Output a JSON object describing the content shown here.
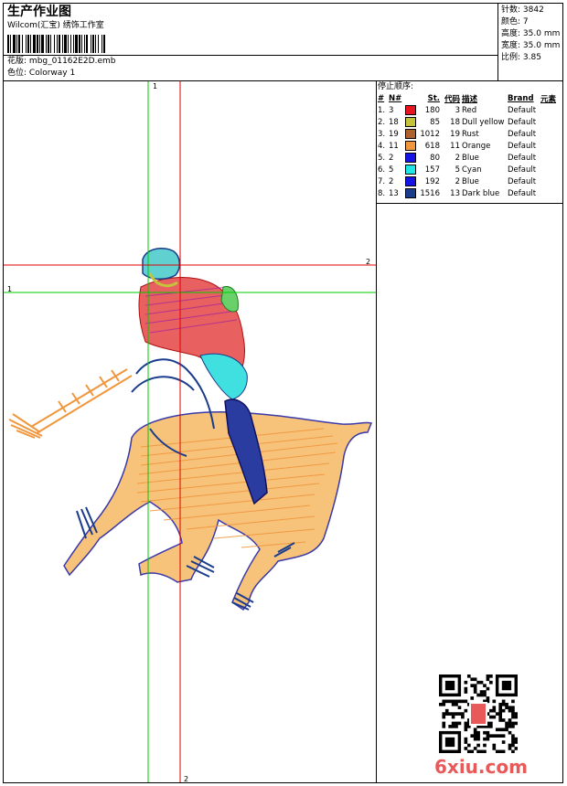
{
  "header": {
    "title": "生产作业图",
    "studio": "Wilcom(汇宝) 绣饰工作室",
    "design_file_label": "花版:",
    "design_file": "mbg_01162E2D.emb",
    "colorway_label": "色位:",
    "colorway": "Colorway 1"
  },
  "stats": [
    {
      "label": "针数:",
      "value": "3842"
    },
    {
      "label": "颜色:",
      "value": "7"
    },
    {
      "label": "高度:",
      "value": "35.0 mm"
    },
    {
      "label": "宽度:",
      "value": "35.0 mm"
    },
    {
      "label": "比例:",
      "value": "3.85"
    }
  ],
  "stop_sequence": {
    "title": "停止顺序:",
    "columns": [
      "#",
      "N#",
      "St.",
      "代码",
      "描述",
      "Brand",
      "元素"
    ],
    "rows": [
      {
        "idx": "1.",
        "needle": "3",
        "color": "#e8141e",
        "stitches": "180",
        "code": "3",
        "desc": "Red",
        "brand": "Default"
      },
      {
        "idx": "2.",
        "needle": "18",
        "color": "#c4c43a",
        "stitches": "85",
        "code": "18",
        "desc": "Dull yellow",
        "brand": "Default"
      },
      {
        "idx": "3.",
        "needle": "19",
        "color": "#b0602c",
        "stitches": "1012",
        "code": "19",
        "desc": "Rust",
        "brand": "Default"
      },
      {
        "idx": "4.",
        "needle": "11",
        "color": "#f0963c",
        "stitches": "618",
        "code": "11",
        "desc": "Orange",
        "brand": "Default"
      },
      {
        "idx": "5.",
        "needle": "2",
        "color": "#1414e6",
        "stitches": "80",
        "code": "2",
        "desc": "Blue",
        "brand": "Default"
      },
      {
        "idx": "6.",
        "needle": "5",
        "color": "#1ee6e6",
        "stitches": "157",
        "code": "5",
        "desc": "Cyan",
        "brand": "Default"
      },
      {
        "idx": "7.",
        "needle": "2",
        "color": "#1414e6",
        "stitches": "192",
        "code": "2",
        "desc": "Blue",
        "brand": "Default"
      },
      {
        "idx": "8.",
        "needle": "13",
        "color": "#1a3c8c",
        "stitches": "1516",
        "code": "13",
        "desc": "Dark blue",
        "brand": "Default"
      }
    ]
  },
  "guides": {
    "green_v_label": "1",
    "green_h_label": "1",
    "red_h_label": "2",
    "red_v_label": "2"
  },
  "watermark": "6xiu.com",
  "colors": {
    "green_guide": "#00cc00",
    "red_guide": "#e00000",
    "watermark": "#e85a5a"
  }
}
